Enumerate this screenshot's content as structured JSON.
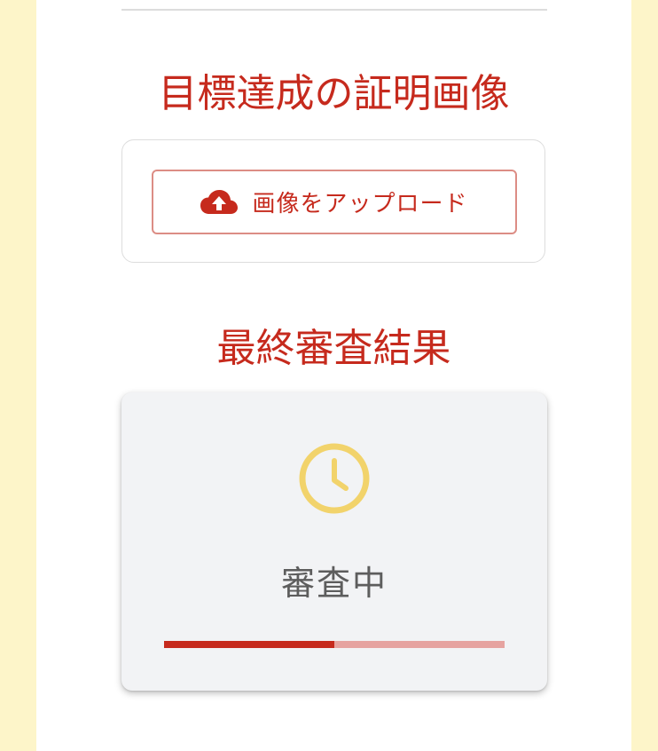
{
  "sections": {
    "proof_title": "目標達成の証明画像",
    "result_title": "最終審査結果"
  },
  "upload": {
    "button_label": "画像をアップロード",
    "icon": "cloud-upload-icon"
  },
  "review": {
    "status_label": "審査中",
    "status_icon": "clock-icon",
    "progress_fraction": 0.5
  },
  "colors": {
    "accent_red": "#c62a1d",
    "progress_track": "#e6a3a0",
    "pending_yellow": "#f2d36b",
    "page_background": "#fdf5c9"
  }
}
